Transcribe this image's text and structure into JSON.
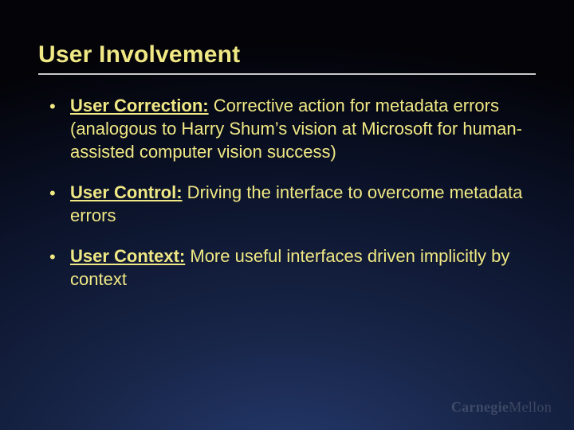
{
  "title": "User Involvement",
  "bullets": [
    {
      "key": "User Correction:",
      "rest": " Corrective action for metadata errors (analogous to Harry Shum’s vision at Microsoft for human-assisted computer vision success)"
    },
    {
      "key": "User Control:",
      "rest": " Driving the interface to overcome metadata errors"
    },
    {
      "key": "User Context:",
      "rest": " More useful interfaces driven implicitly by context"
    }
  ],
  "wordmark": {
    "a": "Carnegie",
    "b": "Mellon"
  }
}
